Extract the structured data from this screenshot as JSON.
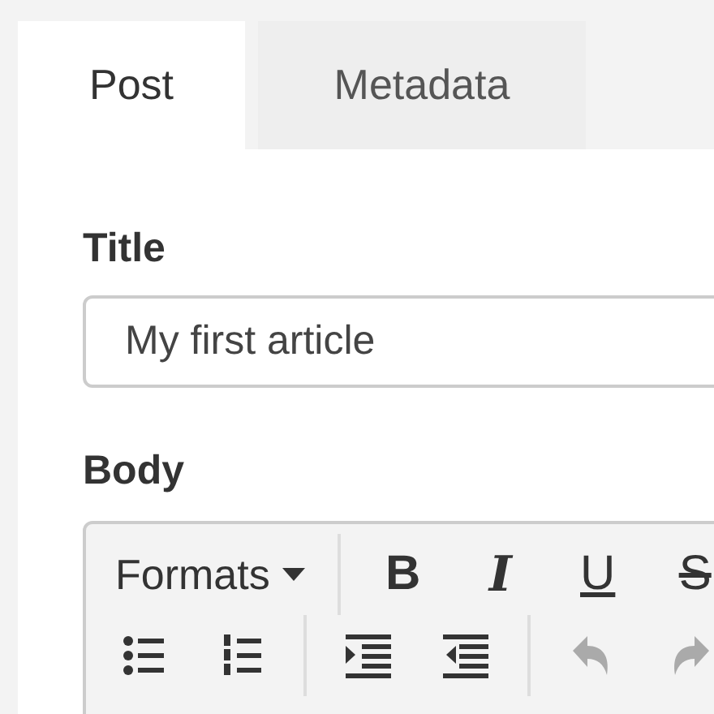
{
  "tabs": [
    {
      "label": "Post",
      "selected": true
    },
    {
      "label": "Metadata",
      "selected": false
    }
  ],
  "fields": [
    {
      "label": "Title",
      "value": "My first article"
    }
  ],
  "body": {
    "label": "Body",
    "toolbar": [
      [
        {
          "kind": "dropdown",
          "label": "Formats"
        },
        {
          "kind": "separator"
        },
        {
          "kind": "bold",
          "label": "B"
        },
        {
          "kind": "italic",
          "label": "I"
        },
        {
          "kind": "underline",
          "label": "U"
        },
        {
          "kind": "strike",
          "label": "S"
        }
      ],
      [
        {
          "kind": "bullets"
        },
        {
          "kind": "numbers"
        },
        {
          "kind": "separator"
        },
        {
          "kind": "indent"
        },
        {
          "kind": "outdent"
        },
        {
          "kind": "separator"
        },
        {
          "kind": "undo",
          "disabled": true
        },
        {
          "kind": "redo",
          "disabled": true
        }
      ]
    ]
  }
}
